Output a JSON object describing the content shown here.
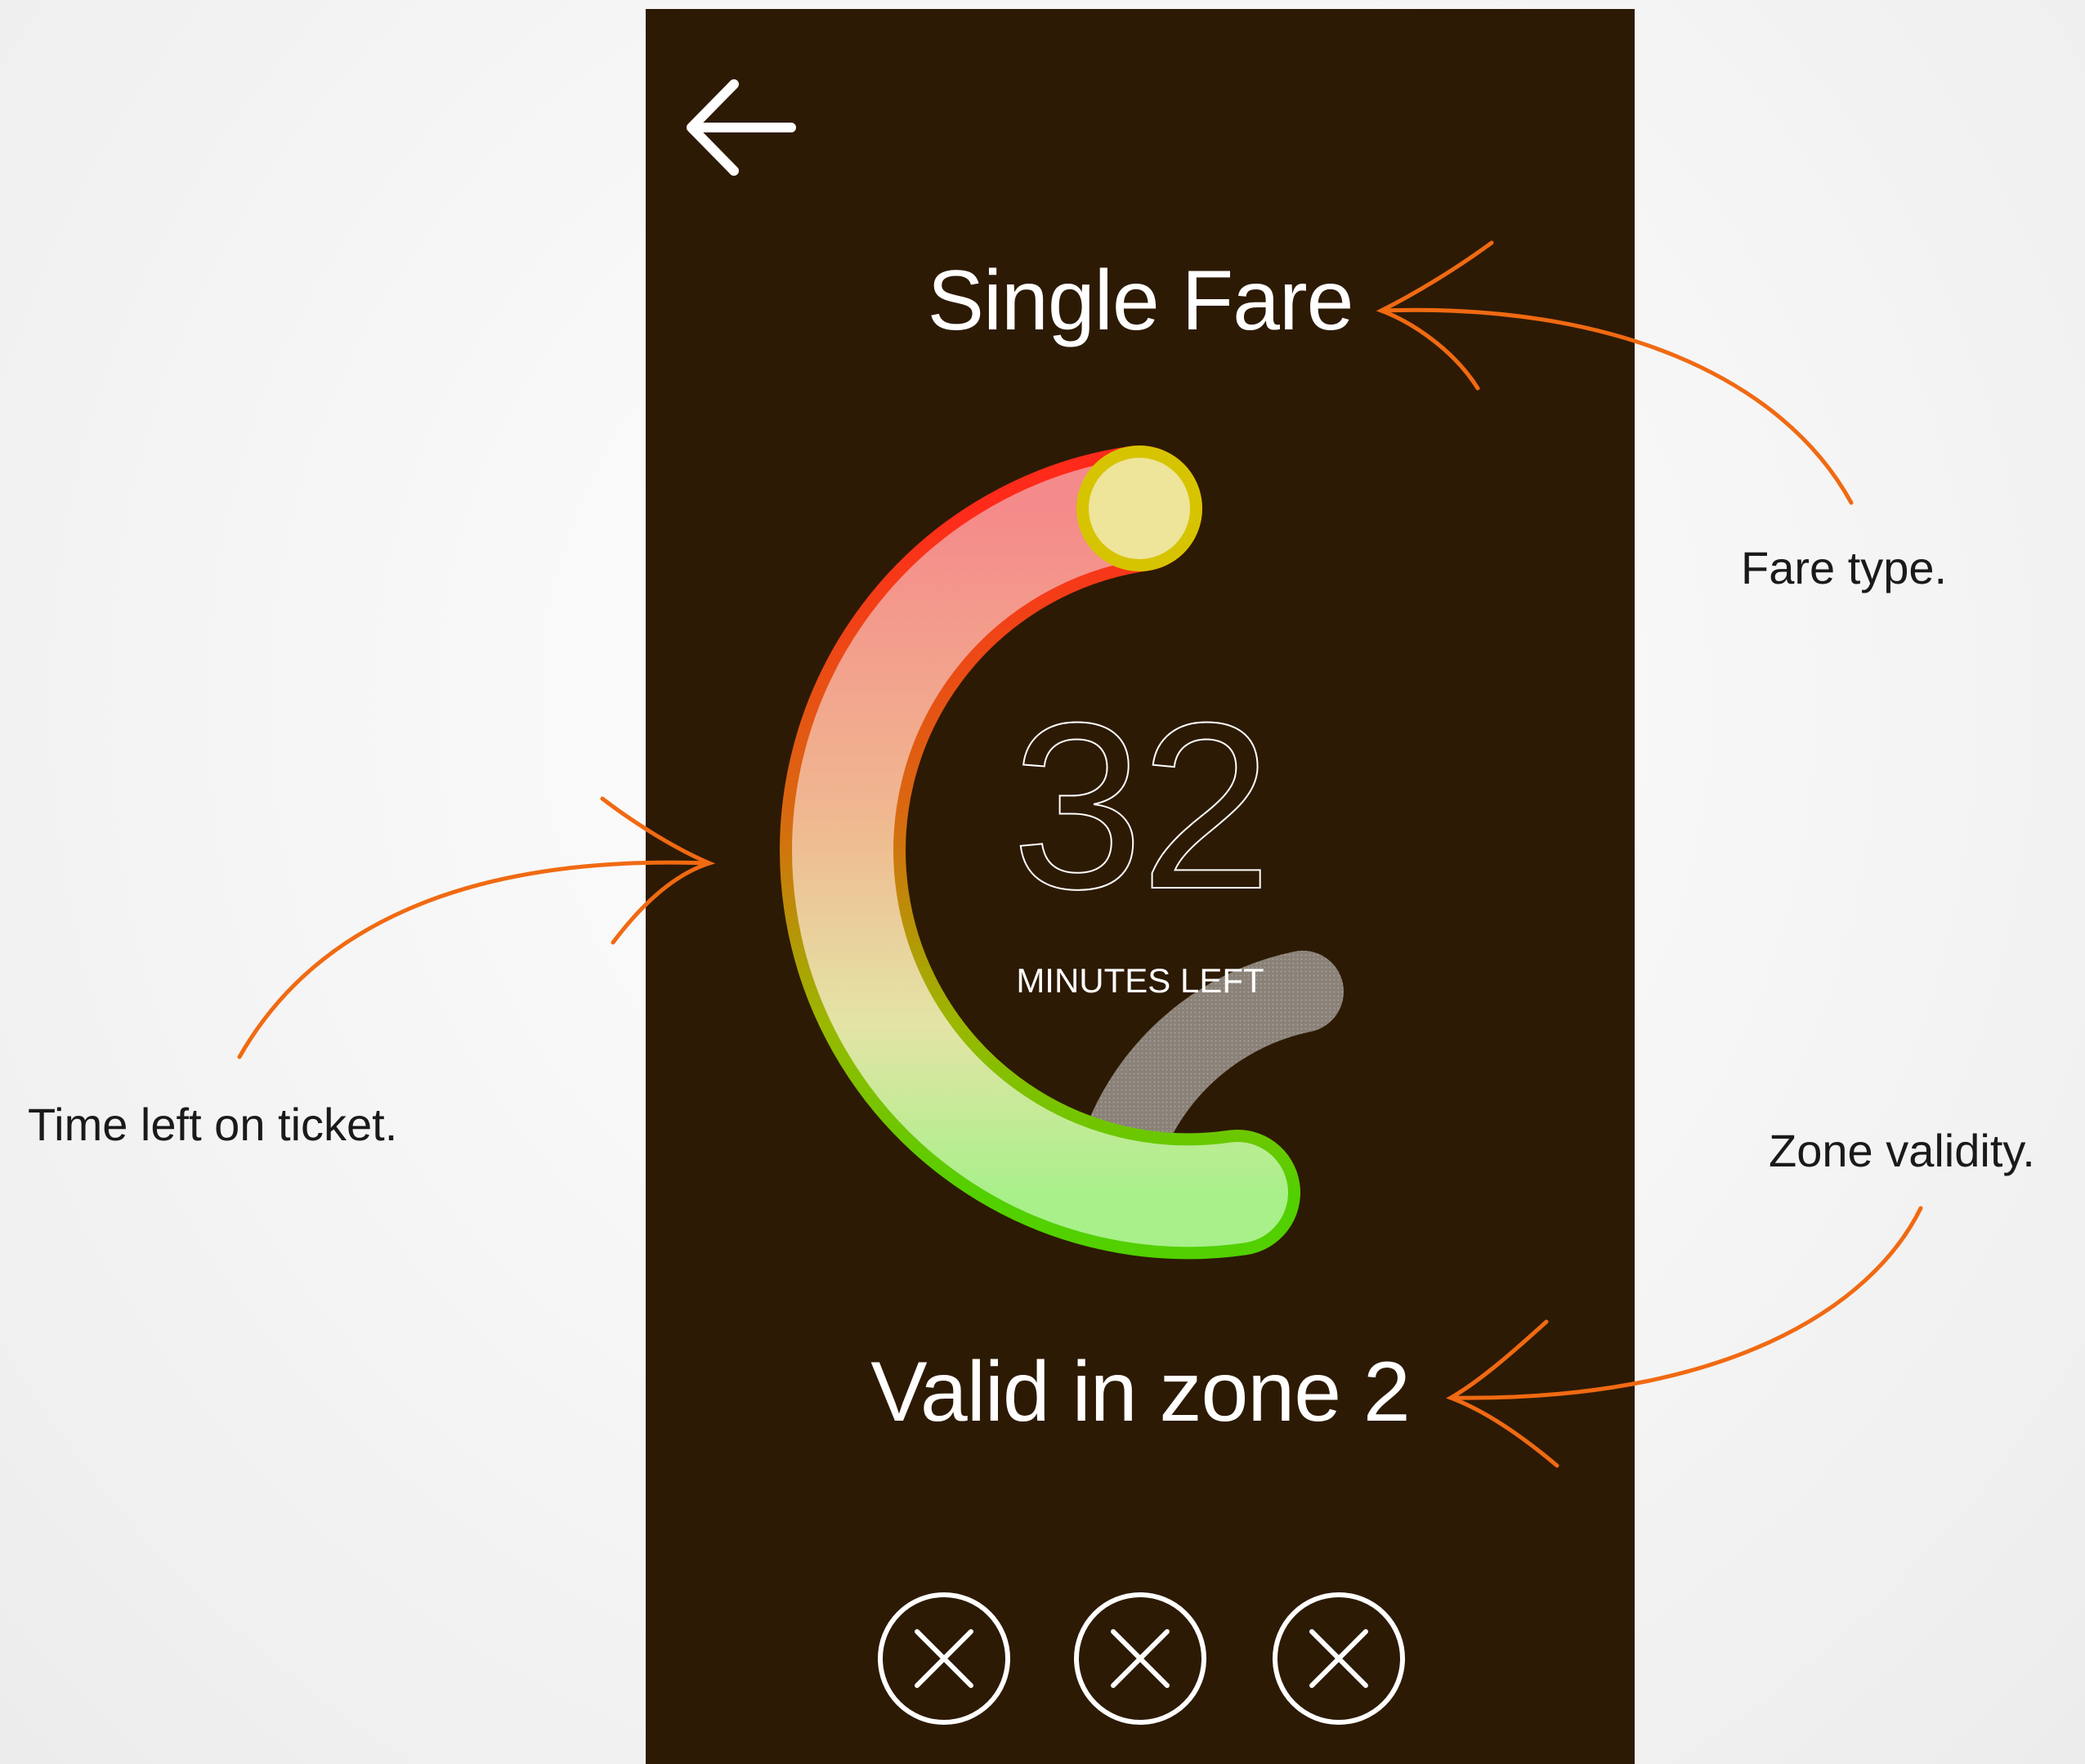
{
  "ticket": {
    "fare_type": "Single Fare",
    "minutes_left": "32",
    "minutes_label": "MINUTES LEFT",
    "zone_text": "Valid in zone 2",
    "remaining_fraction": 0.62
  },
  "nav": {
    "back_icon": "arrow-left-icon"
  },
  "actions": {
    "icons": [
      "close-icon",
      "close-icon",
      "close-icon"
    ]
  },
  "annotations": {
    "fare_type": "Fare type.",
    "time_left": "Time left on ticket.",
    "zone_validity": "Zone validity."
  },
  "colors": {
    "phone_background": "#2d1a04",
    "gauge_start": "#e6d200",
    "gauge_mid": "#ff2a1a",
    "gauge_end": "#52d000",
    "track": "#8a8178",
    "annotation_arrow": "#f06a12"
  }
}
